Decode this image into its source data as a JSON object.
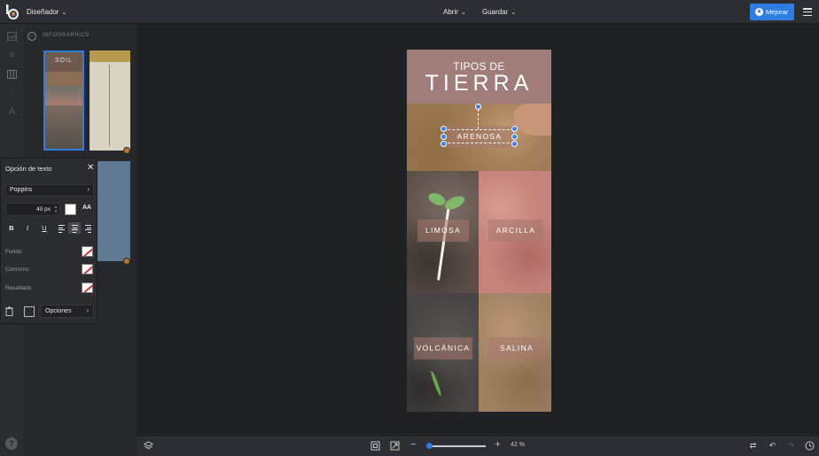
{
  "topbar": {
    "designer_label": "Diseñador",
    "open_label": "Abrir",
    "save_label": "Guardar",
    "upgrade_label": "Mejorar",
    "accent_color": "#2f7de1"
  },
  "sidepanel": {
    "title": "INFOGRAPHICS",
    "thumb1_title": "SOIL"
  },
  "text_panel": {
    "title": "Opción de texto",
    "font": "Poppins",
    "size_value": "40 px",
    "text_color": "#ffffff",
    "case_label": "AA",
    "bold": "B",
    "italic": "I",
    "underline": "U",
    "background_label": "Fondo",
    "outline_label": "Contorno",
    "highlight_label": "Resaltado",
    "options_label": "Opciones"
  },
  "canvas": {
    "heading_small": "TIPOS DE",
    "heading_big": "TIERRA",
    "labels": {
      "arenosa": "ARENOSA",
      "limosa": "LIMOSA",
      "arcilla": "ARCILLA",
      "volcanica": "VOLCÁNICA",
      "salina": "SALINA"
    }
  },
  "bottombar": {
    "zoom": "42 %"
  },
  "icons": [
    "logo-icon",
    "image-icon",
    "text-icon",
    "columns-icon",
    "heart-icon",
    "font-icon",
    "help-icon",
    "back-arrow-icon",
    "star-icon",
    "hamburger-icon",
    "layers-icon",
    "fit-screen-icon",
    "full-screen-icon",
    "zoom-out-icon",
    "zoom-in-icon",
    "repeat-icon",
    "undo-icon",
    "redo-icon",
    "history-icon",
    "trash-icon",
    "copy-icon",
    "close-icon"
  ]
}
